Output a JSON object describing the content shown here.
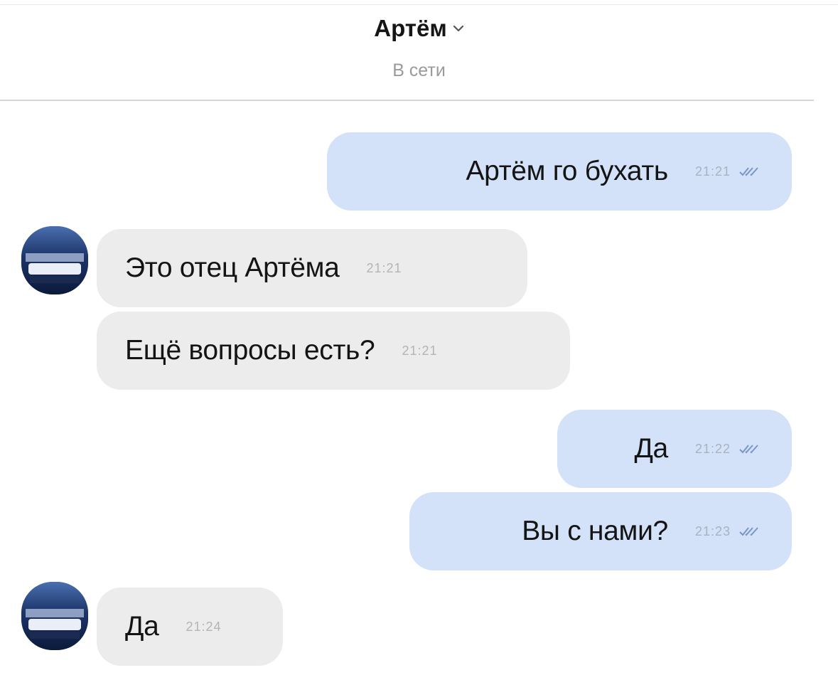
{
  "header": {
    "contact_name": "Артём",
    "status": "В сети"
  },
  "icons": {
    "dropdown": "chevron-down-icon",
    "read_receipt": "double-check-icon",
    "avatar": "contact-avatar"
  },
  "colors": {
    "outgoing_bubble": "#d3e2f8",
    "incoming_bubble": "#ececed",
    "read_ticks": "#7a95c8"
  },
  "messages": [
    {
      "direction": "outgoing",
      "text": "Артём го бухать",
      "time": "21:21",
      "read": true
    },
    {
      "direction": "incoming",
      "text": "Это отец Артёма",
      "time": "21:21",
      "avatar": true
    },
    {
      "direction": "incoming",
      "text": "Ещё вопросы есть?",
      "time": "21:21",
      "avatar": false
    },
    {
      "direction": "outgoing",
      "text": "Да",
      "time": "21:22",
      "read": true
    },
    {
      "direction": "outgoing",
      "text": "Вы с нами?",
      "time": "21:23",
      "read": true
    },
    {
      "direction": "incoming",
      "text": "Да",
      "time": "21:24",
      "avatar": true
    }
  ]
}
